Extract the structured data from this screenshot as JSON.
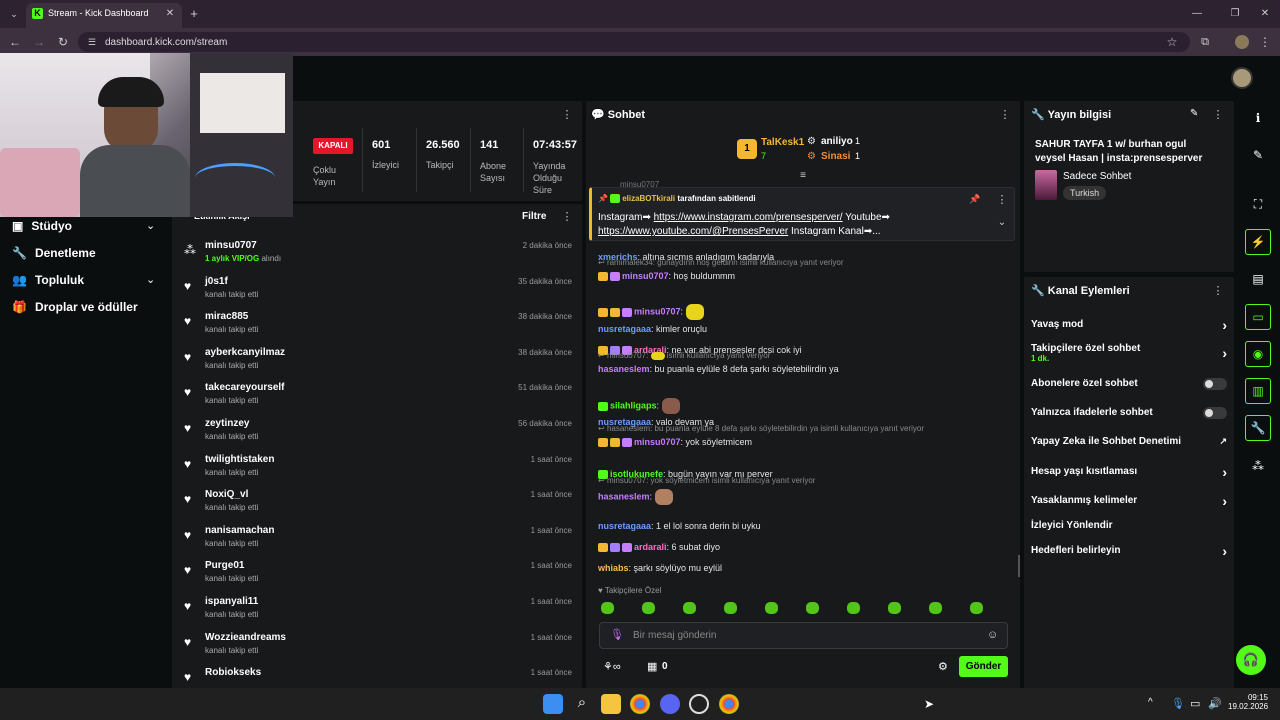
{
  "browser": {
    "tab_title": "Stream - Kick Dashboard",
    "url": "dashboard.kick.com/stream"
  },
  "stats": {
    "status_badge": "KAPALI",
    "multistream_label": "Çoklu Yayın",
    "viewers": "601",
    "viewers_label": "İzleyici",
    "followers": "26.560",
    "followers_label": "Takipçi",
    "subs": "141",
    "subs_label": "Abone Sayısı",
    "uptime": "07:43:57",
    "uptime_label": "Yayında Olduğu Süre"
  },
  "nav": {
    "studio": "Stüdyo",
    "moderation": "Denetleme",
    "community": "Topluluk",
    "drops": "Droplar ve ödüller"
  },
  "activity": {
    "title": "Etkinlik Akışı",
    "filter": "Filtre",
    "items": [
      {
        "name": "minsu0707",
        "sub": "1 aylık VIP/OG",
        "sub2": "alındı",
        "time": "2 dakika önce"
      },
      {
        "name": "j0s1f",
        "sub": "kanalı takip etti",
        "time": "35 dakika önce"
      },
      {
        "name": "mirac885",
        "sub": "kanalı takip etti",
        "time": "38 dakika önce"
      },
      {
        "name": "ayberkcanyilmaz",
        "sub": "kanalı takip etti",
        "time": "38 dakika önce"
      },
      {
        "name": "takecareyourself",
        "sub": "kanalı takip etti",
        "time": "51 dakika önce"
      },
      {
        "name": "zeytinzey",
        "sub": "kanalı takip etti",
        "time": "56 dakika önce"
      },
      {
        "name": "twilightistaken",
        "sub": "kanalı takip etti",
        "time": "1 saat önce"
      },
      {
        "name": "NoxiQ_vl",
        "sub": "kanalı takip etti",
        "time": "1 saat önce"
      },
      {
        "name": "nanisamachan",
        "sub": "kanalı takip etti",
        "time": "1 saat önce"
      },
      {
        "name": "Purge01",
        "sub": "kanalı takip etti",
        "time": "1 saat önce"
      },
      {
        "name": "ispanyali11",
        "sub": "kanalı takip etti",
        "time": "1 saat önce"
      },
      {
        "name": "Wozzieandreams",
        "sub": "kanalı takip etti",
        "time": "1 saat önce"
      },
      {
        "name": "Robiokseks",
        "sub": "",
        "time": "1 saat önce"
      }
    ]
  },
  "chat": {
    "title": "Sohbet",
    "leaders": [
      {
        "rank": "1",
        "name": "TalKesk1",
        "count": "7"
      },
      {
        "name": "aniliyo",
        "count": "1"
      },
      {
        "name": "Sinasi",
        "count": "1"
      }
    ],
    "pinned_by": "elizaBOTkirali",
    "pinned_suffix": "tarafından sabitlendi",
    "pinned_prev": "minsu0707",
    "pinned_text_1": "Instagram➡",
    "pinned_link_1": "https://www.instagram.com/prensesperver/",
    "pinned_text_2": "Youtube➡",
    "pinned_link_2": "https://www.youtube.com/@PrensesPerver",
    "pinned_text_3": "Instagram Kanal➡...",
    "messages": [
      {
        "user": "xmerichs",
        "color": "#6b9eff",
        "text": ": altına sıcmıs anladıgım kadarıyla"
      },
      {
        "reply": "ramimalek34: günaydınn hoş geldinn isimli kullanıcıya yanıt veriyor",
        "user": "minsu0707",
        "color": "#c77dff",
        "text": ": hoş buldummm"
      },
      {
        "user": "minsu0707",
        "color": "#c77dff",
        "text": ":"
      },
      {
        "user": "nusretagaaa",
        "color": "#6b9eff",
        "text": ": kimler oruçlu"
      },
      {
        "user": "ardarali",
        "color": "#ff6ec7",
        "text": ": ne var abi prensesler dcsi cok iyi"
      },
      {
        "reply": "minsu0707:",
        "reply2": "isimli kullanıcıya yanıt veriyor",
        "user": "hasaneslem",
        "color": "#c77dff",
        "text": ": bu puanla eylüle 8 defa şarkı söyletebilirdin ya"
      },
      {
        "user": "silahligaps",
        "color": "#53fc18",
        "text": ":"
      },
      {
        "user": "nusretagaaa",
        "color": "#6b9eff",
        "text": ": valo devam ya"
      },
      {
        "reply": "hasaneslem: bu puanla eylüle 8 defa şarkı söyletebilirdin ya isimli kullanıcıya yanıt veriyor",
        "user": "minsu0707",
        "color": "#c77dff",
        "text": ": yok söyletmicem"
      },
      {
        "user": "isotlukunefe",
        "color": "#53fc18",
        "text": ": bugün yayın var mı perver"
      },
      {
        "reply": "minsu0707: yok söyletmicem isimli kullanıcıya yanıt veriyor",
        "user": "hasaneslem",
        "color": "#c77dff",
        "text": ":"
      },
      {
        "user": "nusretagaaa",
        "color": "#6b9eff",
        "text": ": 1 el lol sonra derin bi uyku"
      },
      {
        "user": "ardarali",
        "color": "#ff6ec7",
        "text": ": 6 subat diyo"
      },
      {
        "user": "whiabs",
        "color": "#ffb84d",
        "text": ": şarkı söylüyo mu eylül"
      }
    ],
    "followers_only": "Takipçilere Özel",
    "input_placeholder": "Bir mesaj gönderin",
    "points": "0",
    "send": "Gönder"
  },
  "stream_info": {
    "title": "Yayın bilgisi",
    "stream_title": "SAHUR TAYFA 1 w/ burhan ogul veysel Hasan | insta:prensesperver",
    "category": "Sadece Sohbet",
    "language": "Turkish"
  },
  "channel_actions": {
    "title": "Kanal Eylemleri",
    "slow": "Yavaş mod",
    "followers_only": "Takipçilere özel sohbet",
    "followers_only_sub": "1 dk.",
    "subs_only": "Abonelere özel sohbet",
    "emotes_only": "Yalnızca ifadelerle sohbet",
    "ai_mod": "Yapay Zeka ile Sohbet Denetimi",
    "age": "Hesap yaşı kısıtlaması",
    "banned_words": "Yasaklanmış kelimeler",
    "raid": "İzleyici Yönlendir",
    "goals": "Hedefleri belirleyin"
  },
  "taskbar": {
    "time": "09:15",
    "date": "19.02.2026"
  }
}
